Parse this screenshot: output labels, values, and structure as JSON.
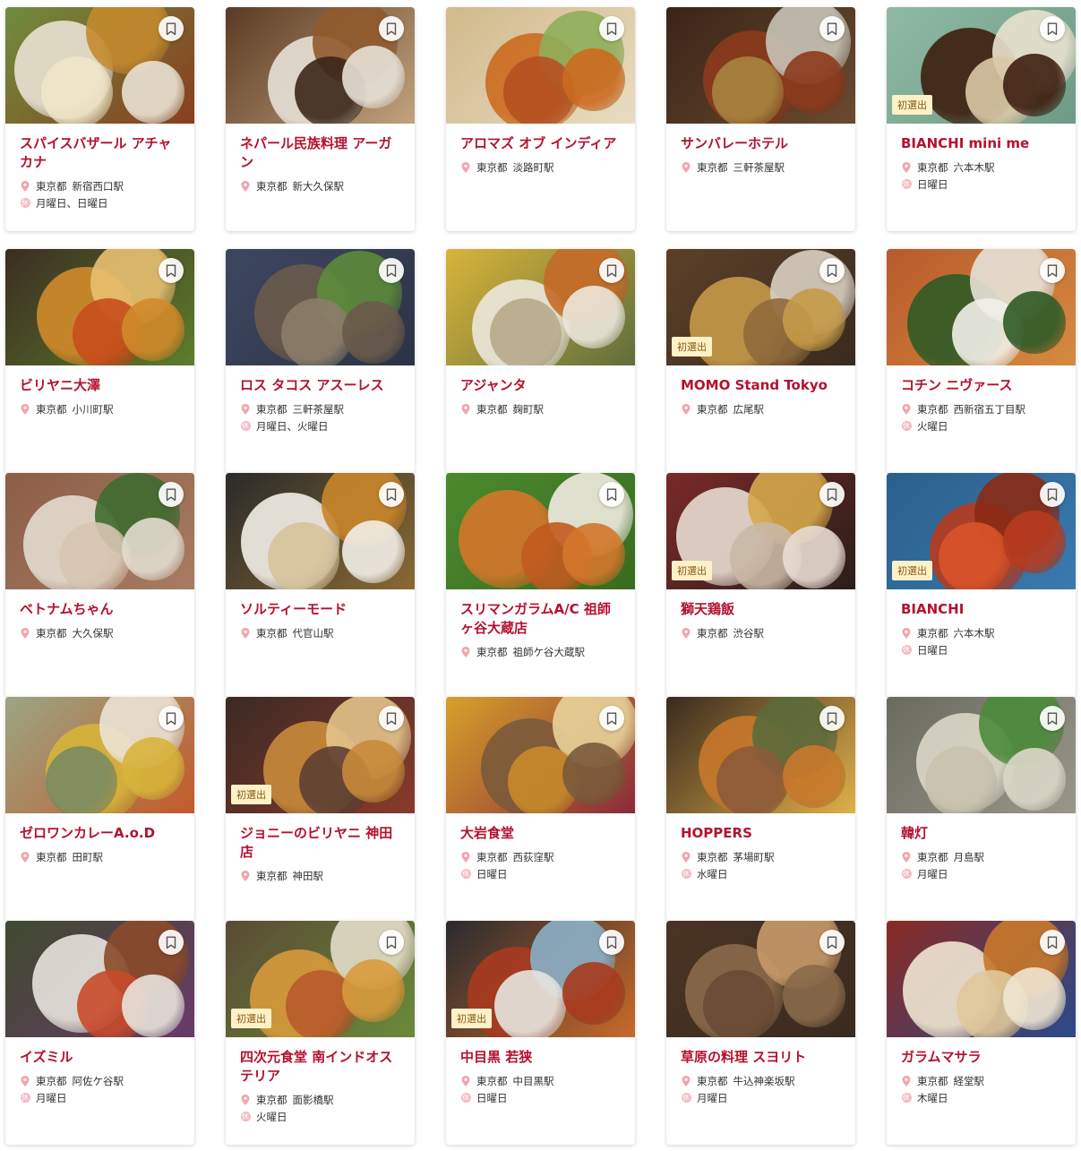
{
  "labels": {
    "pref": "東京都",
    "badge": "初選出"
  },
  "colors": {
    "accent": "#b5112f",
    "badge_bg": "#fdf1c8",
    "pin": "#f3a4b1"
  },
  "restaurants": [
    {
      "name": "スパイスバザール アチャカナ",
      "station": "新宿西口駅",
      "closed": "月曜日、日曜日",
      "badge": false,
      "palette": [
        "#6f8d3c",
        "#e9e2d3",
        "#c48a2e",
        "#8a3d1f",
        "#f0e6c8"
      ]
    },
    {
      "name": "ネパール民族料理 アーガン",
      "station": "新大久保駅",
      "closed": "",
      "badge": false,
      "palette": [
        "#5b3a24",
        "#e7e1d7",
        "#8f5a2c",
        "#c2a37d",
        "#3b2619"
      ]
    },
    {
      "name": "アロマズ オブ インディア",
      "station": "淡路町駅",
      "closed": "",
      "badge": false,
      "palette": [
        "#d1b98a",
        "#cc6a1e",
        "#8fae5a",
        "#e8dcc2",
        "#b64f21"
      ]
    },
    {
      "name": "サンバレーホテル",
      "station": "三軒茶屋駅",
      "closed": "",
      "badge": false,
      "palette": [
        "#3a2418",
        "#8c3a1c",
        "#c8c3b6",
        "#6b4a2f",
        "#a8843f"
      ]
    },
    {
      "name": "BIANCHI mini me",
      "station": "六本木駅",
      "closed": "日曜日",
      "badge": true,
      "palette": [
        "#8fb9a4",
        "#3d1e0f",
        "#e9e2cf",
        "#6e9b86",
        "#d9c8a5"
      ]
    },
    {
      "name": "ビリヤニ大澤",
      "station": "小川町駅",
      "closed": "",
      "badge": false,
      "palette": [
        "#3b2d22",
        "#d18a2a",
        "#e8c070",
        "#5d7d2b",
        "#c84d1b"
      ]
    },
    {
      "name": "ロス タコス アスーレス",
      "station": "三軒茶屋駅",
      "closed": "月曜日、火曜日",
      "badge": false,
      "palette": [
        "#3d4760",
        "#6a5a4a",
        "#5d8b3a",
        "#2d3346",
        "#8c7d6a"
      ]
    },
    {
      "name": "アジャンタ",
      "station": "麹町駅",
      "closed": "",
      "badge": false,
      "palette": [
        "#d9b43a",
        "#ece7dc",
        "#c46a28",
        "#5f6e3c",
        "#b8a889"
      ]
    },
    {
      "name": "MOMO Stand Tokyo",
      "station": "広尾駅",
      "closed": "",
      "badge": true,
      "palette": [
        "#5c4028",
        "#c69a48",
        "#d9cfc1",
        "#3a2a1e",
        "#8f6a3a"
      ]
    },
    {
      "name": "コチン ニヴァース",
      "station": "西新宿五丁目駅",
      "closed": "火曜日",
      "badge": false,
      "palette": [
        "#b85a2c",
        "#2e5a25",
        "#e6e2d8",
        "#d68a3f",
        "#f2f0ea"
      ]
    },
    {
      "name": "ベトナムちゃん",
      "station": "大久保駅",
      "closed": "",
      "badge": false,
      "palette": [
        "#8c5e48",
        "#e3dccf",
        "#3e6b2e",
        "#a87b62",
        "#d8c6b3"
      ]
    },
    {
      "name": "ソルティーモード",
      "station": "代官山駅",
      "closed": "",
      "badge": false,
      "palette": [
        "#2a2a2a",
        "#f2efe8",
        "#c9862a",
        "#8a6a34",
        "#d6c39a"
      ]
    },
    {
      "name": "スリマンガラムA/C 祖師ヶ谷大蔵店",
      "station": "祖師ケ谷大蔵駅",
      "closed": "",
      "badge": false,
      "palette": [
        "#4b8a2c",
        "#d4762a",
        "#f0ebe0",
        "#3a6b20",
        "#c25a1f"
      ]
    },
    {
      "name": "獅天鶏飯",
      "station": "渋谷駅",
      "closed": "",
      "badge": true,
      "palette": [
        "#7a2a28",
        "#e8dcd2",
        "#d6a84a",
        "#2a1e1a",
        "#c9b8a6"
      ]
    },
    {
      "name": "BIANCHI",
      "station": "六本木駅",
      "closed": "日曜日",
      "badge": true,
      "palette": [
        "#2a5f8a",
        "#b83a1e",
        "#8a2a14",
        "#3a7ab0",
        "#d9532a"
      ]
    },
    {
      "name": "ゼロワンカレーA.o.D",
      "station": "田町駅",
      "closed": "",
      "badge": false,
      "palette": [
        "#9aa584",
        "#d7b43a",
        "#ece3d4",
        "#c45a2a",
        "#7a8a62"
      ]
    },
    {
      "name": "ジョニーのビリヤニ 神田店",
      "station": "神田駅",
      "closed": "",
      "badge": true,
      "palette": [
        "#3a2a24",
        "#c88a3a",
        "#e3c28a",
        "#8a3a2a",
        "#5c4032"
      ]
    },
    {
      "name": "大岩食堂",
      "station": "西荻窪駅",
      "closed": "日曜日",
      "badge": false,
      "palette": [
        "#d6a02a",
        "#7a5a3a",
        "#e8d29a",
        "#8a2a3a",
        "#c98a2a"
      ]
    },
    {
      "name": "HOPPERS",
      "station": "茅場町駅",
      "closed": "水曜日",
      "badge": false,
      "palette": [
        "#3a2a1e",
        "#c8782a",
        "#5a6a3a",
        "#e0b04a",
        "#8a5a3a"
      ]
    },
    {
      "name": "韓灯",
      "station": "月島駅",
      "closed": "月曜日",
      "badge": false,
      "palette": [
        "#6a6a5e",
        "#dcd8c8",
        "#4a8a3a",
        "#9a968a",
        "#c8c2ae"
      ]
    },
    {
      "name": "イズミル",
      "station": "阿佐ケ谷駅",
      "closed": "月曜日",
      "badge": false,
      "palette": [
        "#3e4a2e",
        "#e8e4dc",
        "#8a4a2a",
        "#6a3a6a",
        "#c84a2a"
      ]
    },
    {
      "name": "四次元食堂 南インドオステリア",
      "station": "面影橋駅",
      "closed": "火曜日",
      "badge": true,
      "palette": [
        "#5a4a34",
        "#d89a3a",
        "#e4dcc8",
        "#6a8a3a",
        "#b85a2a"
      ]
    },
    {
      "name": "中目黒 若狭",
      "station": "中目黒駅",
      "closed": "日曜日",
      "badge": true,
      "palette": [
        "#2a2a2e",
        "#a83a1e",
        "#8ab0c8",
        "#c86a2a",
        "#e6e6e0"
      ]
    },
    {
      "name": "草原の料理 スヨリト",
      "station": "牛込神楽坂駅",
      "closed": "月曜日",
      "badge": false,
      "palette": [
        "#4a3424",
        "#8a6a4a",
        "#c89a6a",
        "#3a2a1e",
        "#6a4a34"
      ]
    },
    {
      "name": "ガラムマサラ",
      "station": "経堂駅",
      "closed": "木曜日",
      "badge": false,
      "palette": [
        "#8a2a24",
        "#f0e6d2",
        "#c8782a",
        "#2a4a8a",
        "#e0c89a"
      ]
    }
  ]
}
